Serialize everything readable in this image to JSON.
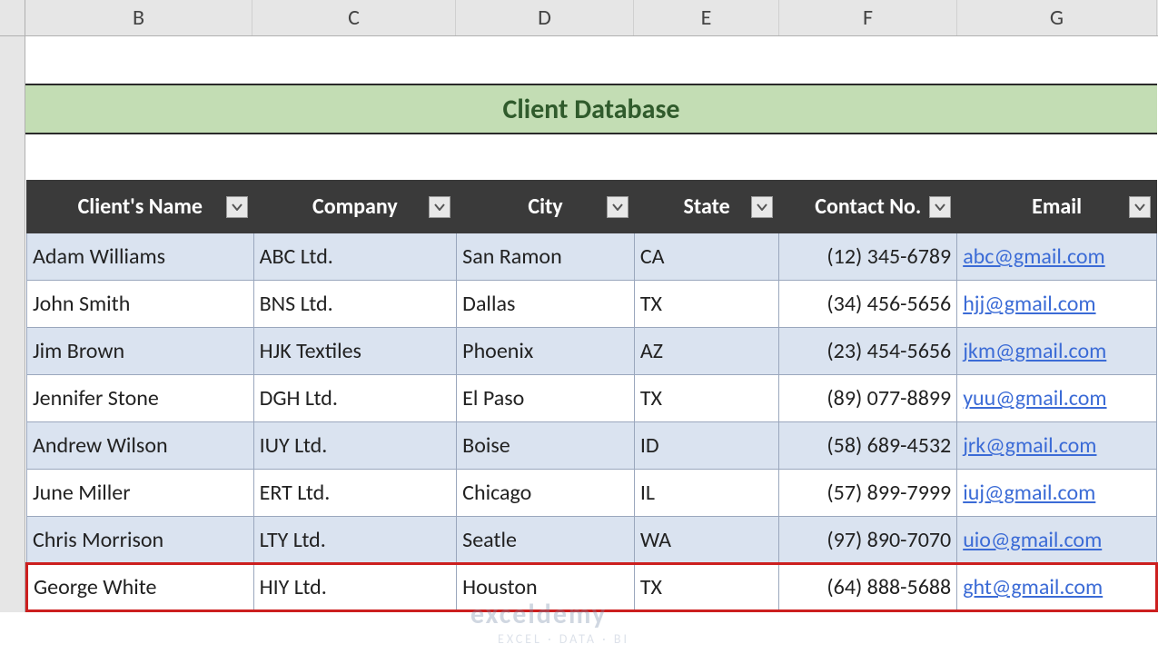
{
  "columns": [
    "B",
    "C",
    "D",
    "E",
    "F",
    "G"
  ],
  "title": "Client Database",
  "headers": {
    "name": "Client's Name",
    "company": "Company",
    "city": "City",
    "state": "State",
    "contact": "Contact No.",
    "email": "Email"
  },
  "rows": [
    {
      "name": "Adam Williams",
      "company": "ABC Ltd.",
      "city": "San Ramon",
      "state": "CA",
      "contact": "(12) 345-6789",
      "email": "abc@gmail.com",
      "banded": true
    },
    {
      "name": "John Smith",
      "company": "BNS Ltd.",
      "city": "Dallas",
      "state": "TX",
      "contact": "(34) 456-5656",
      "email": "hjj@gmail.com",
      "banded": false
    },
    {
      "name": "Jim Brown",
      "company": "HJK Textiles",
      "city": "Phoenix",
      "state": "AZ",
      "contact": "(23) 454-5656",
      "email": "jkm@gmail.com",
      "banded": true
    },
    {
      "name": "Jennifer Stone",
      "company": "DGH Ltd.",
      "city": "El Paso",
      "state": "TX",
      "contact": "(89) 077-8899",
      "email": "yuu@gmail.com",
      "banded": false
    },
    {
      "name": "Andrew Wilson",
      "company": "IUY Ltd.",
      "city": "Boise",
      "state": "ID",
      "contact": "(58) 689-4532",
      "email": "jrk@gmail.com",
      "banded": true
    },
    {
      "name": "June Miller",
      "company": "ERT Ltd.",
      "city": "Chicago",
      "state": "IL",
      "contact": "(57) 899-7999",
      "email": "iuj@gmail.com",
      "banded": false
    },
    {
      "name": "Chris Morrison",
      "company": "LTY Ltd.",
      "city": "Seatle",
      "state": "WA",
      "contact": "(97) 890-7070",
      "email": "uio@gmail.com",
      "banded": true
    },
    {
      "name": "George White",
      "company": "HIY Ltd.",
      "city": "Houston",
      "state": "TX",
      "contact": "(64) 888-5688",
      "email": "ght@gmail.com",
      "banded": false,
      "highlighted": true
    }
  ],
  "watermark": {
    "main": "exceldemy",
    "sub": "EXCEL · DATA · BI"
  }
}
